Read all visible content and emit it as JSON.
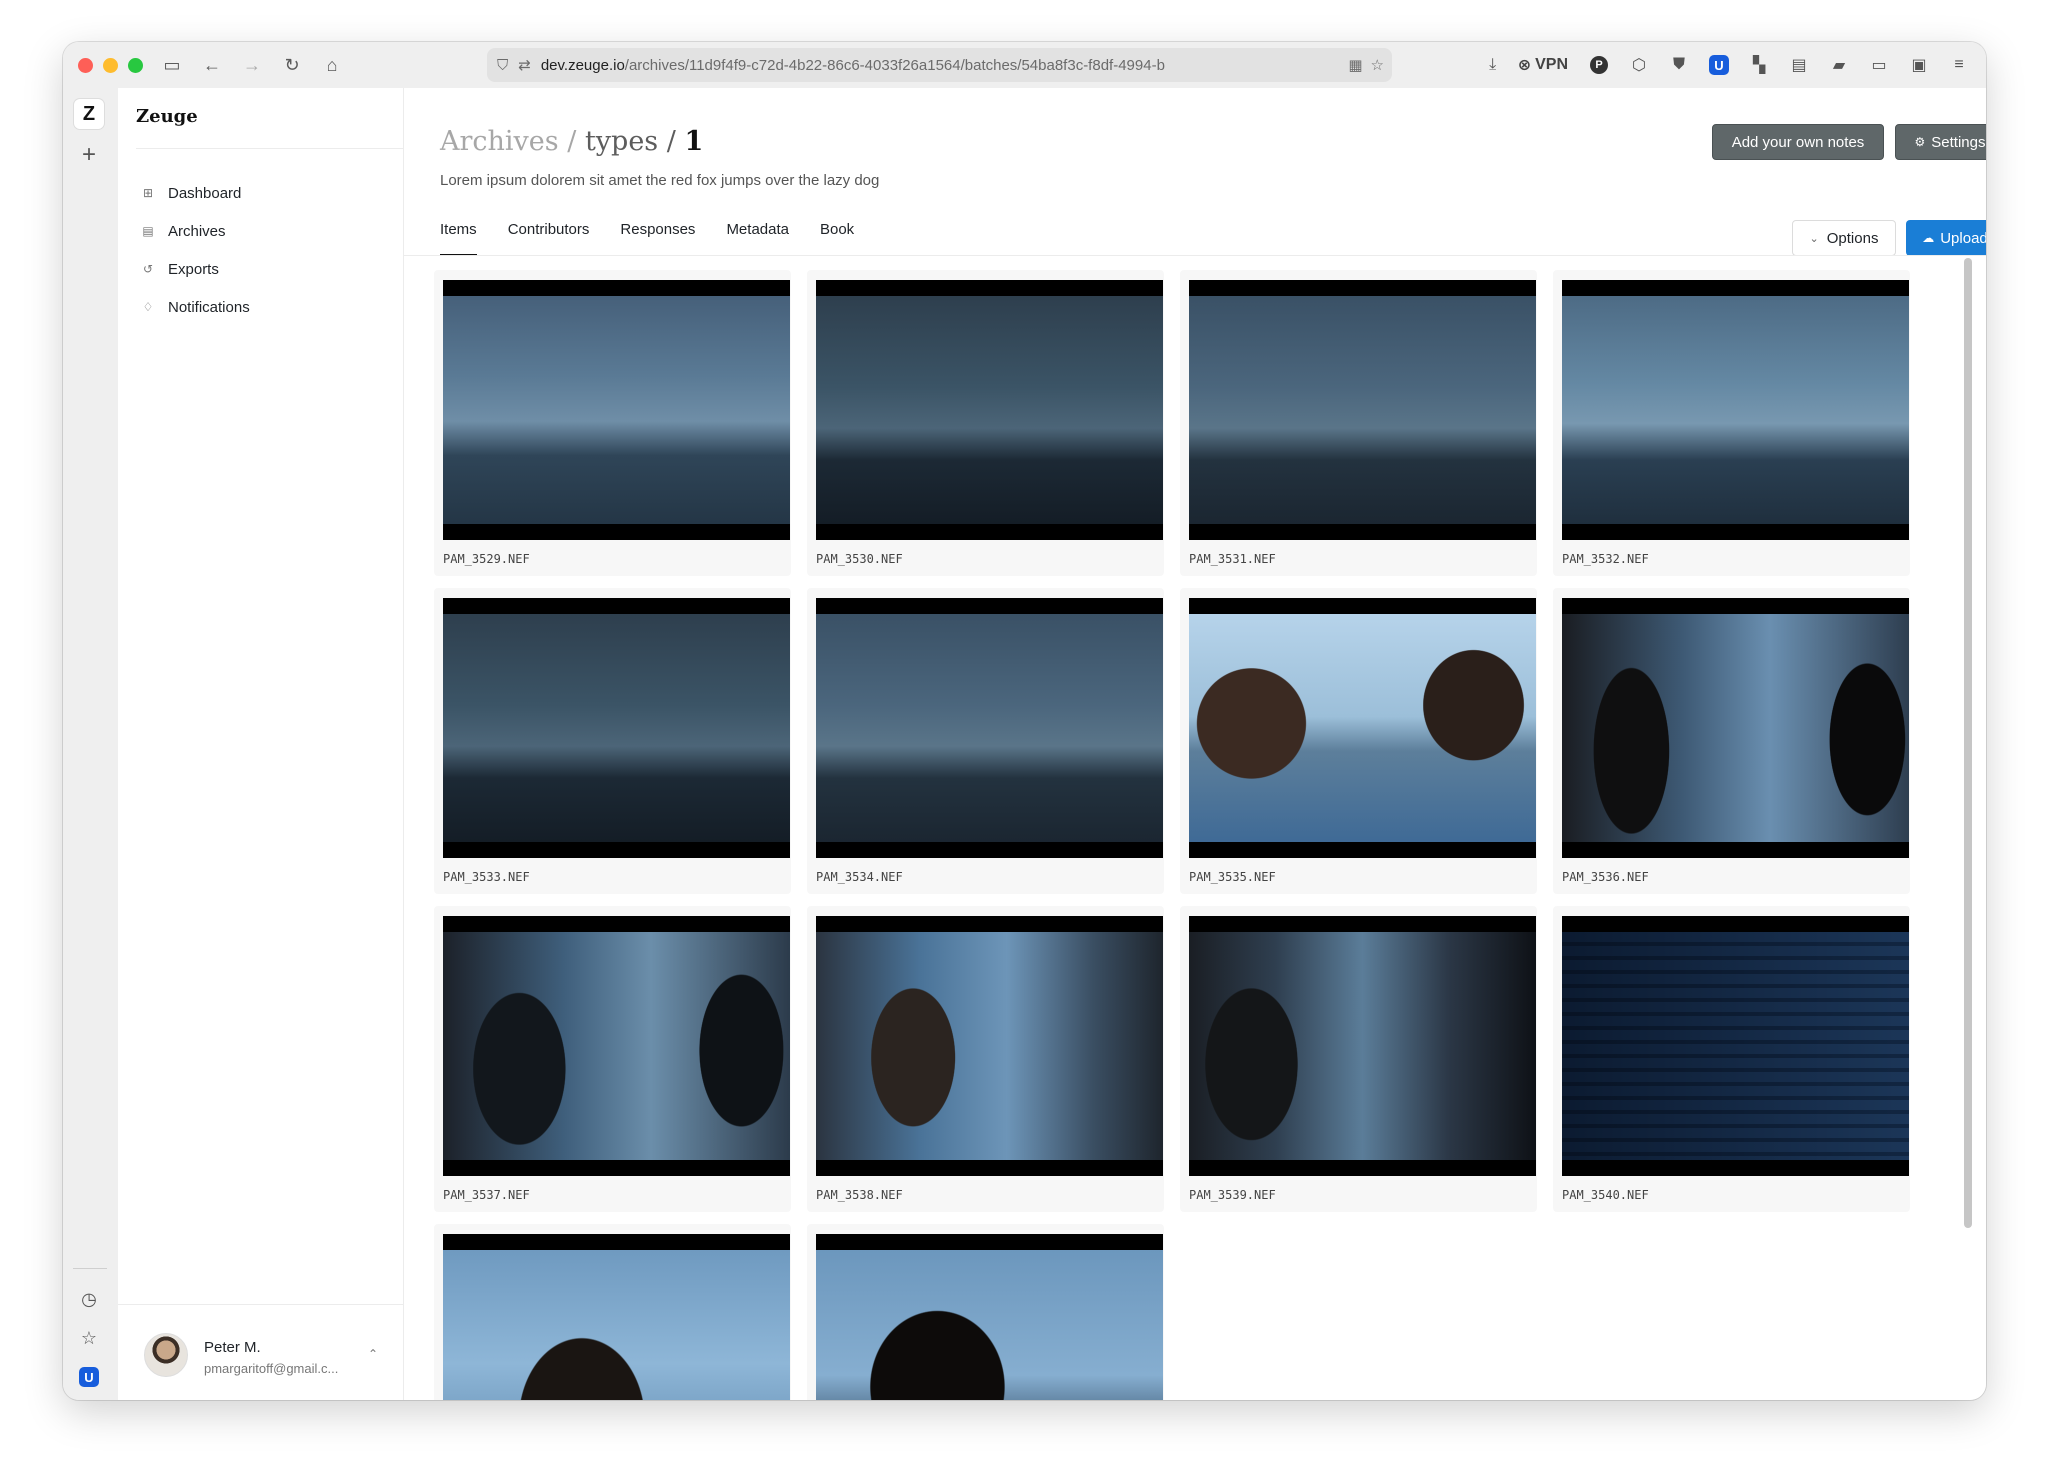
{
  "browser": {
    "url_host": "dev.zeuge.io",
    "url_path": "/archives/11d9f4f9-c72d-4b22-86c6-4033f26a1564/batches/54ba8f3c-f8df-4994-b",
    "vpn_label": "VPN"
  },
  "app": {
    "brand": "Zeuge",
    "rail_logo": "Z"
  },
  "sidebar": {
    "items": [
      {
        "label": "Dashboard",
        "icon": "grid-icon"
      },
      {
        "label": "Archives",
        "icon": "archive-icon"
      },
      {
        "label": "Exports",
        "icon": "export-icon"
      },
      {
        "label": "Notifications",
        "icon": "bell-icon"
      }
    ],
    "user": {
      "name": "Peter M.",
      "email": "pmargaritoff@gmail.c..."
    }
  },
  "header": {
    "crumb1": "Archives",
    "crumb2": "types",
    "crumb3": "1",
    "sep": "/",
    "subtitle": "Lorem ipsum dolorem sit amet the red fox jumps over the lazy dog",
    "notes_button": "Add your own notes",
    "settings_button": "Settings"
  },
  "tabs": [
    {
      "label": "Items",
      "active": true
    },
    {
      "label": "Contributors",
      "active": false
    },
    {
      "label": "Responses",
      "active": false
    },
    {
      "label": "Metadata",
      "active": false
    },
    {
      "label": "Book",
      "active": false
    }
  ],
  "actions": {
    "options_label": "Options",
    "upload_label": "Upload"
  },
  "items": [
    {
      "file": "PAM_3529.NEF",
      "style": "sky1"
    },
    {
      "file": "PAM_3530.NEF",
      "style": "sky2"
    },
    {
      "file": "PAM_3531.NEF",
      "style": "sky3"
    },
    {
      "file": "PAM_3532.NEF",
      "style": "sky4"
    },
    {
      "file": "PAM_3533.NEF",
      "style": "sky2"
    },
    {
      "file": "PAM_3534.NEF",
      "style": "sky3"
    },
    {
      "file": "PAM_3535.NEF",
      "style": "men1"
    },
    {
      "file": "PAM_3536.NEF",
      "style": "men2"
    },
    {
      "file": "PAM_3537.NEF",
      "style": "men3"
    },
    {
      "file": "PAM_3538.NEF",
      "style": "men4"
    },
    {
      "file": "PAM_3539.NEF",
      "style": "men5"
    },
    {
      "file": "PAM_3540.NEF",
      "style": "bldg"
    },
    {
      "file": "",
      "style": "head1"
    },
    {
      "file": "",
      "style": "head2"
    }
  ],
  "colors": {
    "accent": "#1a7ed6",
    "header_button": "#5f6769"
  }
}
